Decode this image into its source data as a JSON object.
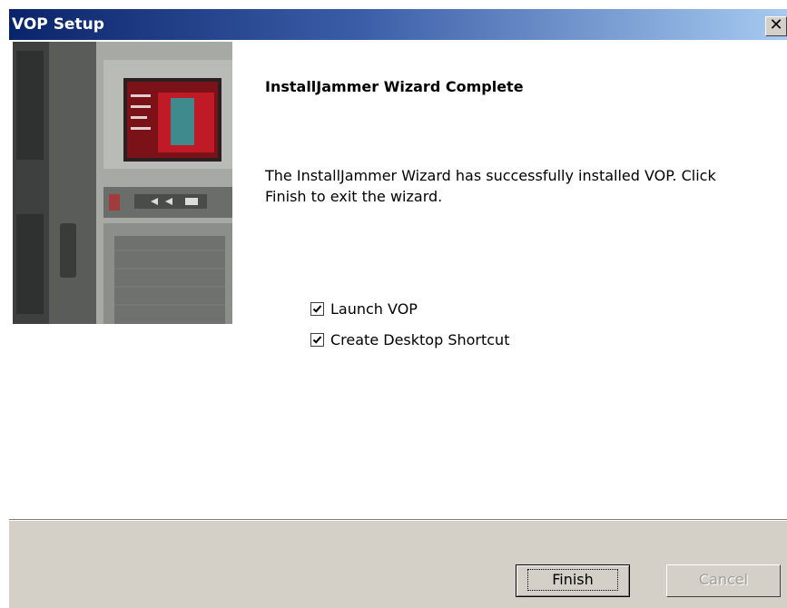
{
  "window": {
    "title": "VOP Setup"
  },
  "main": {
    "heading": "InstallJammer Wizard Complete",
    "description": "The InstallJammer Wizard has successfully installed VOP.  Click Finish to exit the wizard.",
    "options": [
      {
        "label": "Launch VOP",
        "checked": true
      },
      {
        "label": "Create Desktop Shortcut",
        "checked": true
      }
    ]
  },
  "footer": {
    "finish_label": "Finish",
    "cancel_label": "Cancel",
    "cancel_enabled": false
  },
  "colors": {
    "titlebar_start": "#0a246a",
    "titlebar_end": "#a6caf0",
    "dialog_face": "#d4d0c8",
    "disabled_text": "#a09e98"
  },
  "icons": {
    "close": "close-icon",
    "check": "checkmark-icon"
  }
}
